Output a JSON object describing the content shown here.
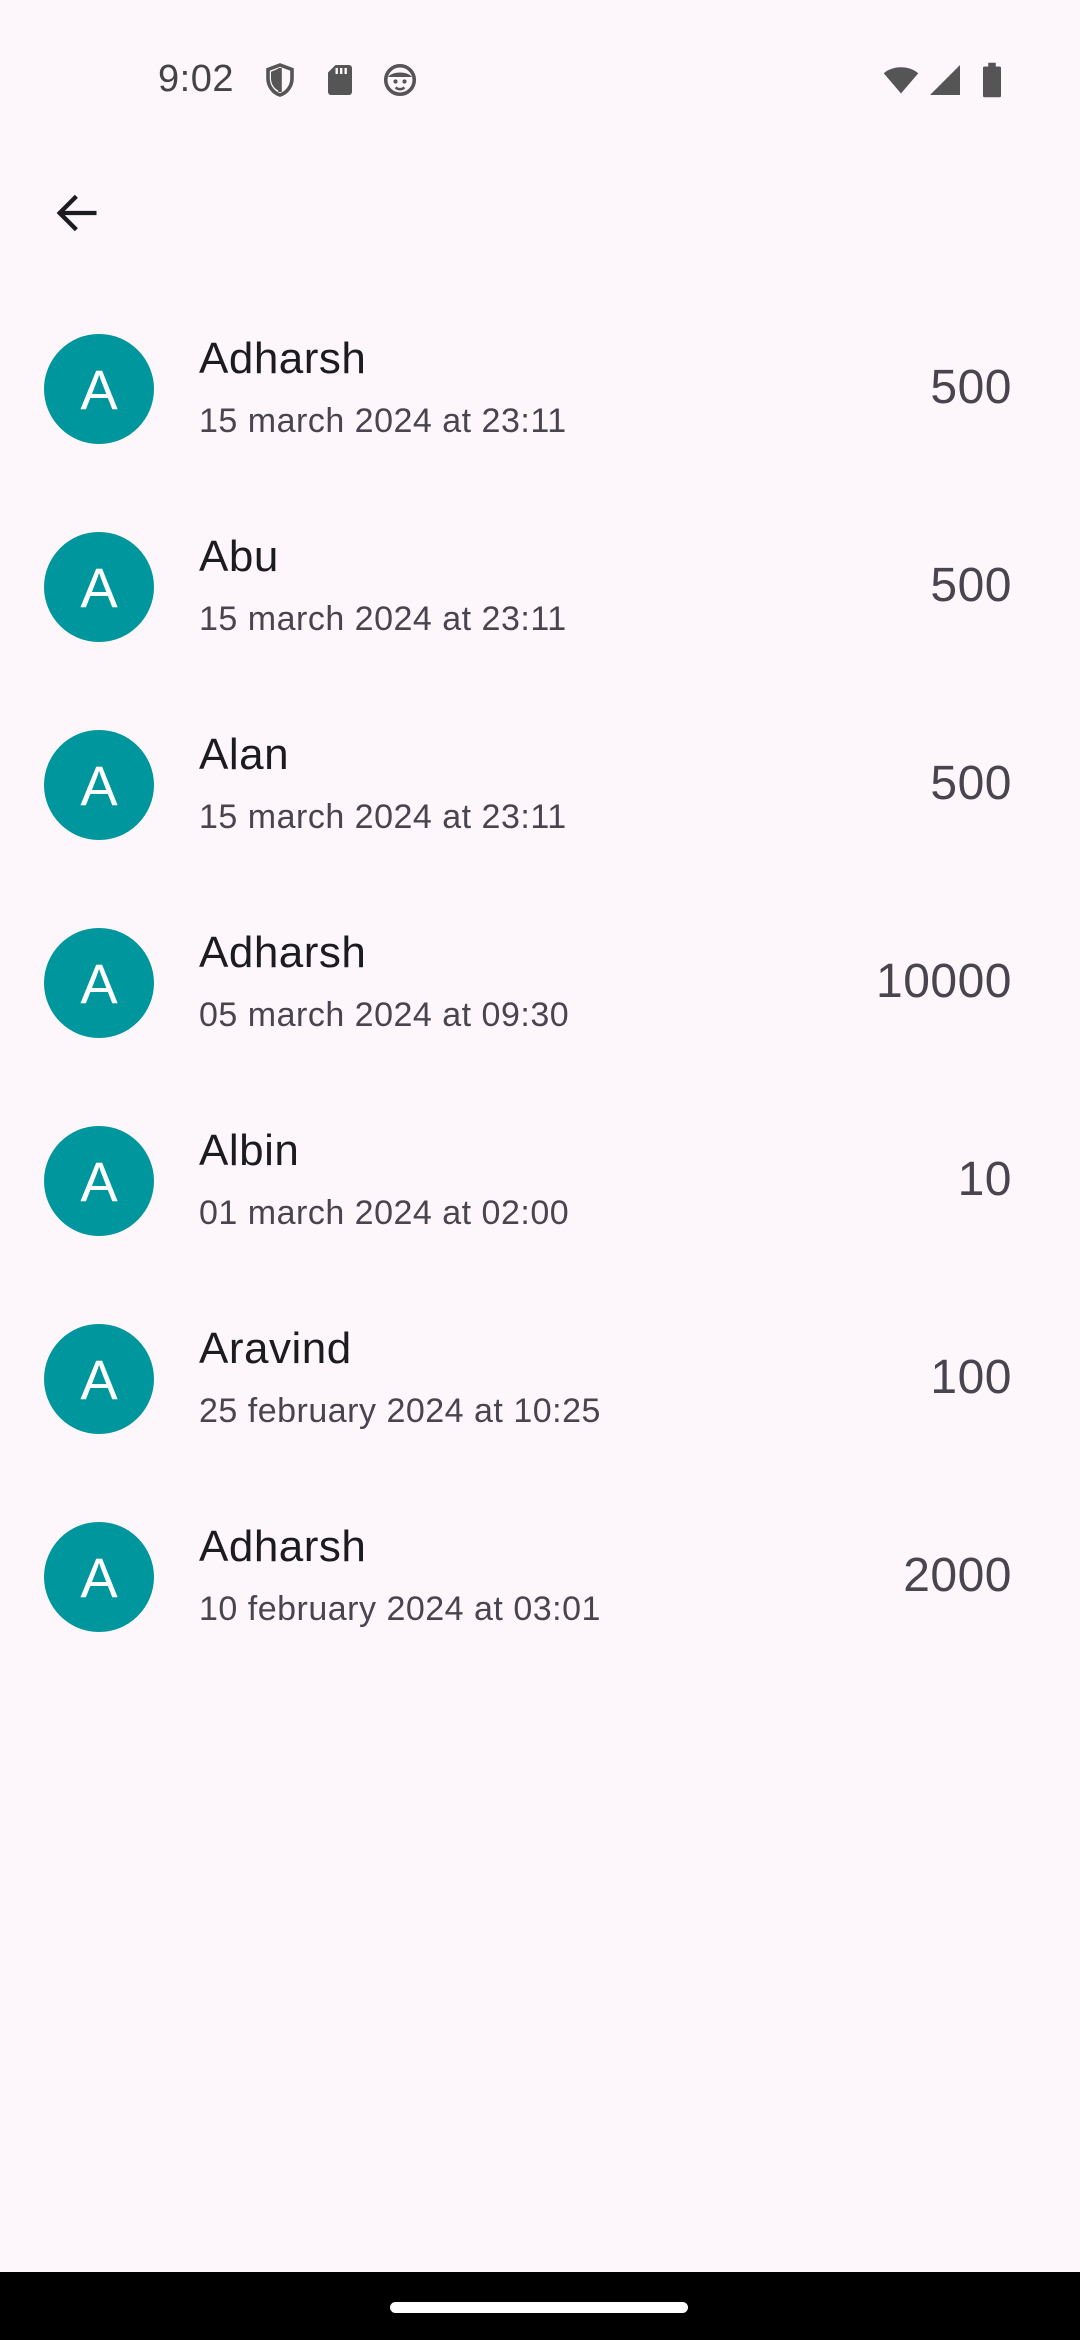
{
  "status_bar": {
    "time": "9:02",
    "left_icons": [
      "shield-icon",
      "sd-card-icon",
      "face-icon"
    ],
    "right_icons": [
      "wifi-icon",
      "cellular-signal-icon",
      "battery-icon"
    ]
  },
  "app_bar": {
    "back_icon": "arrow-back-icon"
  },
  "colors": {
    "avatar_bg": "#00969d",
    "background": "#fdf7fc"
  },
  "transactions": [
    {
      "initial": "A",
      "name": "Adharsh",
      "date": "15 march 2024 at 23:11",
      "amount": "500"
    },
    {
      "initial": "A",
      "name": "Abu",
      "date": "15 march 2024 at 23:11",
      "amount": "500"
    },
    {
      "initial": "A",
      "name": "Alan",
      "date": "15 march 2024 at 23:11",
      "amount": "500"
    },
    {
      "initial": "A",
      "name": "Adharsh",
      "date": "05 march 2024 at 09:30",
      "amount": "10000"
    },
    {
      "initial": "A",
      "name": "Albin",
      "date": "01 march 2024 at 02:00",
      "amount": "10"
    },
    {
      "initial": "A",
      "name": "Aravind",
      "date": "25 february 2024 at 10:25",
      "amount": "100"
    },
    {
      "initial": "A",
      "name": "Adharsh",
      "date": "10 february 2024 at 03:01",
      "amount": "2000"
    }
  ]
}
